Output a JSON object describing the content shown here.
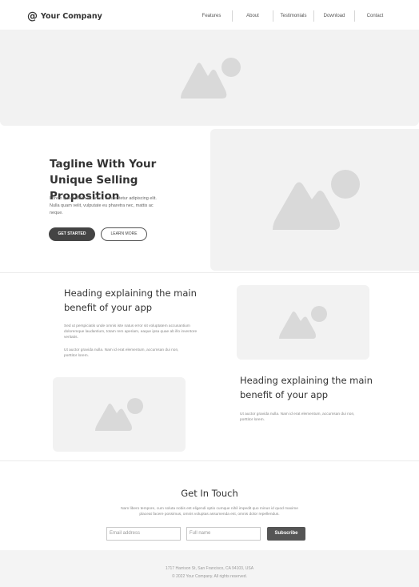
{
  "header": {
    "logo_symbol": "@",
    "company_name": "Your Company",
    "nav": [
      "Features",
      "About",
      "Testimonials",
      "Download",
      "Contact"
    ]
  },
  "hero": {
    "tagline": "Tagline With Your Unique Selling Proposition",
    "text": "Lorem ipsum dolor sit amet, consectetur adipiscing elit. Nulla quam velit, vulputate eu pharetra nec, mattis ac neque.",
    "primary_button": "GET STARTED",
    "secondary_button": "LEARN MORE"
  },
  "features": [
    {
      "heading": "Heading explaining the main benefit of your app",
      "paragraph1": "Sed ut perspiciatis unde omnis iste natus error sit voluptatem accusantium doloremque laudantium, totam rem aperiam, eaque ipsa quae ab illo inventore veritatis.",
      "paragraph2": "Ut auctor gravida nulla. Nam id erat elementum, accumsan dui non, porttitor lorem."
    },
    {
      "heading": "Heading explaining the main benefit of your app",
      "paragraph1": "Ut auctor gravida nulla. Nam id erat elementum, accumsan dui non, porttitor lorem."
    }
  ],
  "contact": {
    "title": "Get In Touch",
    "text": "Nam libero tempore, cum soluta nobis est eligendi optio cumque nihil impedit quo minus id quod maxime placeat facere possimus, omnis voluptas assumenda est, omnis dolor repellendus.",
    "email_placeholder": "Email address",
    "name_placeholder": "Full name",
    "subscribe_label": "Subscribe"
  },
  "footer": {
    "address": "1717 Harrison St, San Francisco, CA 94103, USA",
    "copyright": "© 2022 Your Company.  All rights reserved."
  },
  "colors": {
    "placeholder_bg": "#f2f2f2",
    "placeholder_shape": "#d9d9d9",
    "primary_button": "#444444"
  }
}
